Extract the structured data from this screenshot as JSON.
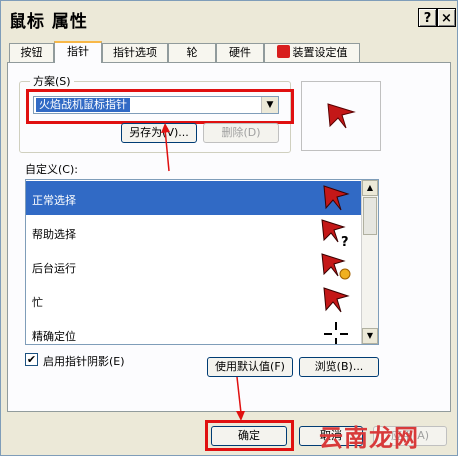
{
  "window": {
    "title": "鼠标 属性"
  },
  "title_buttons": {
    "help": "?",
    "close": "×"
  },
  "tabs": [
    {
      "label": "按钮"
    },
    {
      "label": "指针"
    },
    {
      "label": "指针选项"
    },
    {
      "label": "轮"
    },
    {
      "label": "硬件"
    },
    {
      "label": "装置设定值"
    }
  ],
  "scheme": {
    "group_label": "方案(S)",
    "selected": "火焰战机鼠标指针",
    "save_as": "另存为(V)...",
    "delete": "删除(D)"
  },
  "custom": {
    "label": "自定义(C):",
    "rows": [
      {
        "label": "正常选择",
        "icon": "arrow-cursor-icon"
      },
      {
        "label": "帮助选择",
        "icon": "help-cursor-icon"
      },
      {
        "label": "后台运行",
        "icon": "working-cursor-icon"
      },
      {
        "label": "忙",
        "icon": "busy-cursor-icon"
      },
      {
        "label": "精确定位",
        "icon": "crosshair-cursor-icon"
      }
    ]
  },
  "shadow": {
    "label": "启用指针阴影(E)",
    "checked": true
  },
  "buttons": {
    "use_default": "使用默认值(F)",
    "browse": "浏览(B)...",
    "ok": "确定",
    "cancel": "取消",
    "apply": "应用(A)"
  },
  "watermark": "云南龙网",
  "colors": {
    "highlight": "#e01010",
    "selection": "#316ac5"
  }
}
